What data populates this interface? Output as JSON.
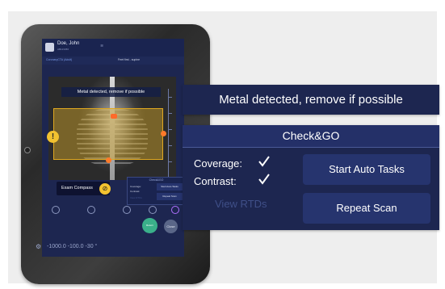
{
  "tablet": {
    "header": {
      "patient_name": "Doe, John",
      "patient_id": "AB123456",
      "status_icon": "wifi-icon"
    },
    "subheader": {
      "protocol": "CoronaryCTA (Adult)",
      "position": "Feet first - supine"
    },
    "viewer_alert": "Metal detected, remove if possible",
    "warning_glyph": "!",
    "exam_compass_label": "Exam Compass",
    "compass_glyph": "⊘",
    "mini_panel": {
      "title": "Check&GO",
      "coverage_label": "Coverage:",
      "contrast_label": "Contrast:",
      "view_rtds": "View RTDs",
      "auto_tasks": "Start Auto Tasks",
      "repeat_scan": "Repeat Scan"
    },
    "buttons": {
      "green": "Return",
      "grey": "Close"
    },
    "coords": "-1000.0  -100.0  -30 °",
    "gear_glyph": "⚙"
  },
  "alert_banner": {
    "text": "Metal detected, remove if possible"
  },
  "check_go": {
    "title": "Check&GO",
    "coverage_label": "Coverage:",
    "contrast_label": "Contrast:",
    "view_rtds_label": "View RTDs",
    "start_auto_tasks_label": "Start Auto Tasks",
    "repeat_scan_label": "Repeat Scan",
    "coverage_ok": true,
    "contrast_ok": true
  },
  "colors": {
    "panel_bg": "#1d2650",
    "panel_title_bg": "#243068",
    "button_bg": "#26346e",
    "disabled_text": "#3f4f88",
    "coverage_box": "#e0a820",
    "handle": "#ff7a2a",
    "accent_yellow": "#f2c230"
  }
}
